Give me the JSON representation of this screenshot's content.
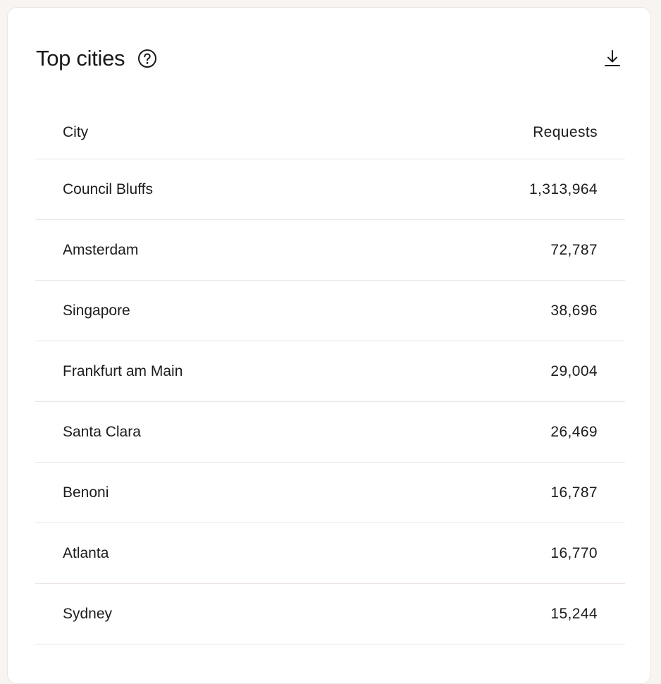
{
  "card": {
    "title": "Top cities",
    "help_icon": "question-circle-icon",
    "download_icon": "download-icon"
  },
  "table": {
    "columns": [
      "City",
      "Requests"
    ],
    "rows": [
      {
        "city": "Council Bluffs",
        "requests": "1,313,964"
      },
      {
        "city": "Amsterdam",
        "requests": "72,787"
      },
      {
        "city": "Singapore",
        "requests": "38,696"
      },
      {
        "city": "Frankfurt am Main",
        "requests": "29,004"
      },
      {
        "city": "Santa Clara",
        "requests": "26,469"
      },
      {
        "city": "Benoni",
        "requests": "16,787"
      },
      {
        "city": "Atlanta",
        "requests": "16,770"
      },
      {
        "city": "Sydney",
        "requests": "15,244"
      }
    ]
  }
}
